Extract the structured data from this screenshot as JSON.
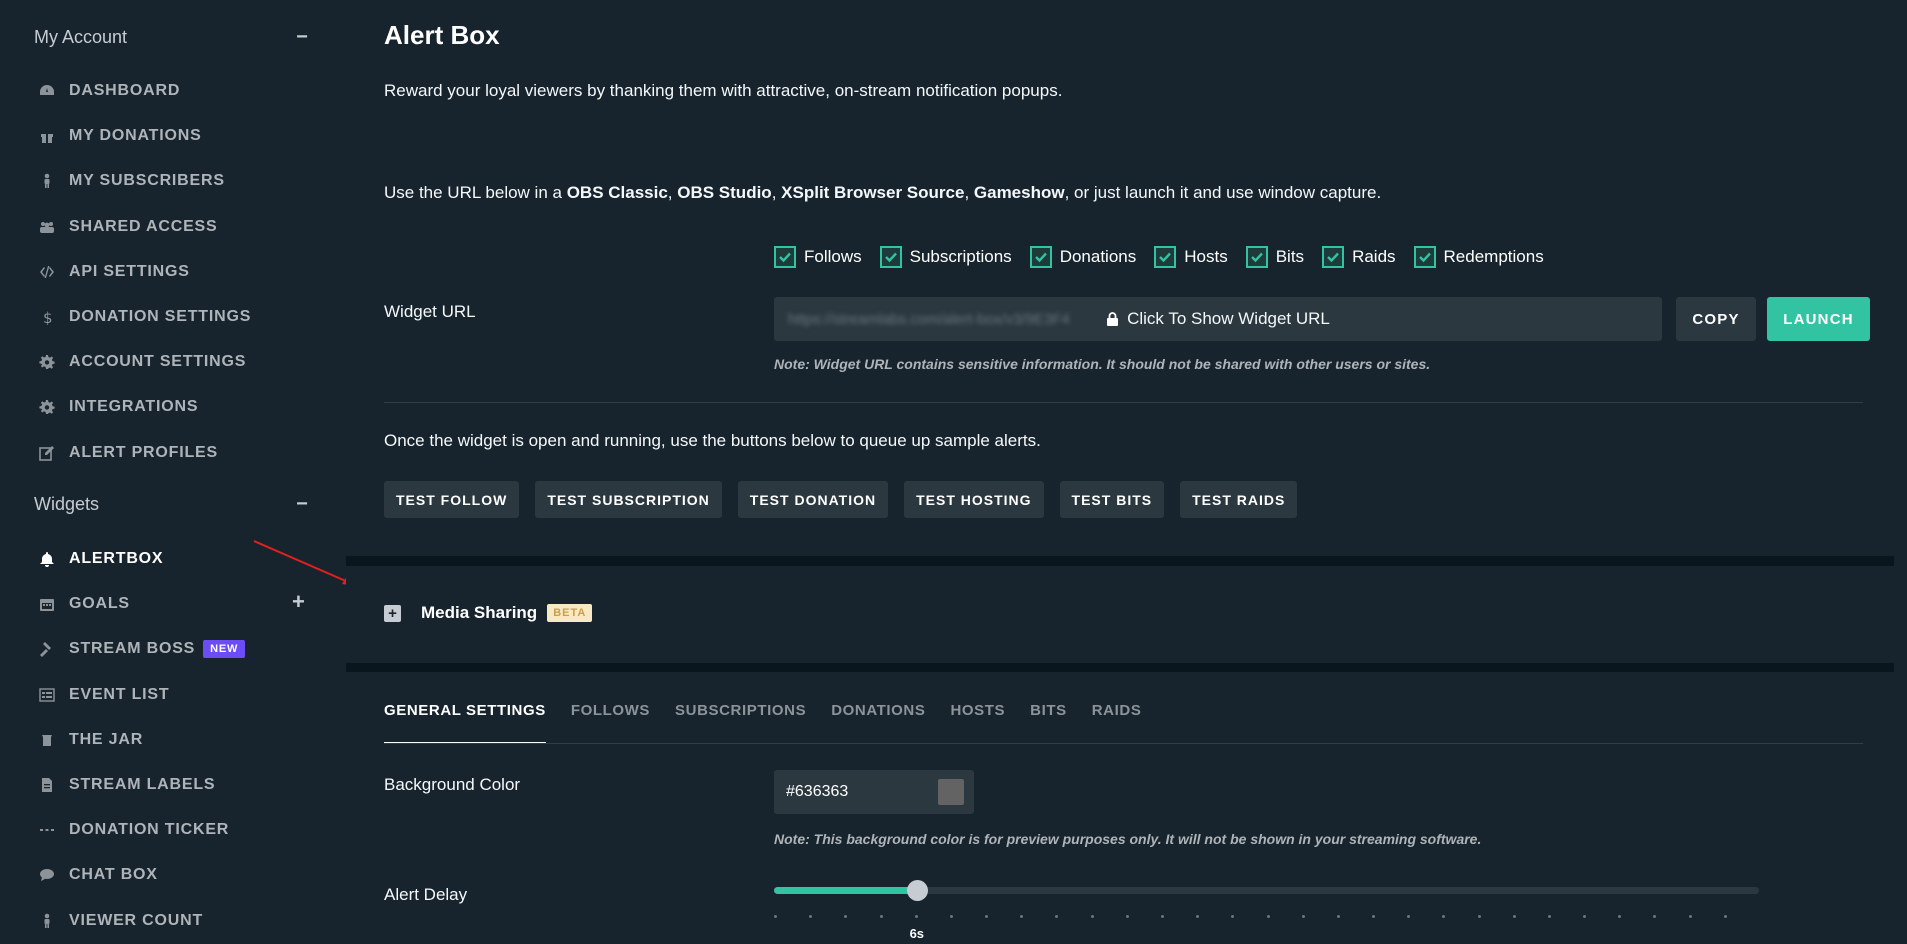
{
  "sidebar": {
    "account_title": "My Account",
    "account_toggle": "−",
    "account_items": [
      {
        "label": "DASHBOARD",
        "icon": "dashboard-icon"
      },
      {
        "label": "MY DONATIONS",
        "icon": "gift-icon"
      },
      {
        "label": "MY SUBSCRIBERS",
        "icon": "person-icon"
      },
      {
        "label": "SHARED ACCESS",
        "icon": "users-icon"
      },
      {
        "label": "API SETTINGS",
        "icon": "code-icon"
      },
      {
        "label": "DONATION SETTINGS",
        "icon": "dollar-icon"
      },
      {
        "label": "ACCOUNT SETTINGS",
        "icon": "gear-icon"
      },
      {
        "label": "INTEGRATIONS",
        "icon": "gear-icon"
      },
      {
        "label": "ALERT PROFILES",
        "icon": "edit-icon"
      }
    ],
    "widgets_title": "Widgets",
    "widgets_toggle": "−",
    "widget_items": [
      {
        "label": "ALERTBOX",
        "icon": "bell-icon",
        "active": true
      },
      {
        "label": "GOALS",
        "icon": "calendar-icon"
      },
      {
        "label": "STREAM BOSS",
        "icon": "hammer-icon",
        "badge": "NEW"
      },
      {
        "label": "EVENT LIST",
        "icon": "list-icon"
      },
      {
        "label": "THE JAR",
        "icon": "jar-icon"
      },
      {
        "label": "STREAM LABELS",
        "icon": "file-icon"
      },
      {
        "label": "DONATION TICKER",
        "icon": "ellipsis-icon"
      },
      {
        "label": "CHAT BOX",
        "icon": "chat-icon"
      },
      {
        "label": "VIEWER COUNT",
        "icon": "person-icon"
      }
    ],
    "goals_toggle": "+"
  },
  "main": {
    "title": "Alert Box",
    "intro": "Reward your loyal viewers by thanking them with attractive, on-stream notification popups.",
    "url_instructions": {
      "prefix": "Use the URL below in a ",
      "obs_classic": "OBS Classic",
      "sep1": ", ",
      "obs_studio": "OBS Studio",
      "sep2": ", ",
      "xsplit": "XSplit Browser Source",
      "sep3": ", ",
      "gameshow": "Gameshow",
      "suffix": ", or just launch it and use window capture."
    },
    "widget_url_label": "Widget URL",
    "event_checks": [
      "Follows",
      "Subscriptions",
      "Donations",
      "Hosts",
      "Bits",
      "Raids",
      "Redemptions"
    ],
    "url_placeholder_blurred": "https://streamlabs.com/alert-box/v3/9E3F4",
    "url_show_label": "Click To Show Widget URL",
    "copy_label": "COPY",
    "launch_label": "LAUNCH",
    "url_note": "Note: Widget URL contains sensitive information. It should not be shared with other users or sites.",
    "test_intro": "Once the widget is open and running, use the buttons below to queue up sample alerts.",
    "test_buttons": [
      "TEST FOLLOW",
      "TEST SUBSCRIPTION",
      "TEST DONATION",
      "TEST HOSTING",
      "TEST BITS",
      "TEST RAIDS"
    ],
    "media_sharing_label": "Media Sharing",
    "media_sharing_badge": "BETA",
    "tabs": [
      "GENERAL SETTINGS",
      "FOLLOWS",
      "SUBSCRIPTIONS",
      "DONATIONS",
      "HOSTS",
      "BITS",
      "RAIDS"
    ],
    "active_tab": "GENERAL SETTINGS",
    "bg_color_label": "Background Color",
    "bg_color_value": "#636363",
    "bg_color_note": "Note: This background color is for preview purposes only. It will not be shown in your streaming software.",
    "alert_delay_label": "Alert Delay",
    "alert_delay_value": "6s",
    "alert_delay_fraction": 0.145,
    "alert_delay_ticks": 28
  },
  "colors": {
    "accent": "#31c3a2",
    "new_badge": "#6c4cf5",
    "annotation_arrow": "#e3201c"
  }
}
